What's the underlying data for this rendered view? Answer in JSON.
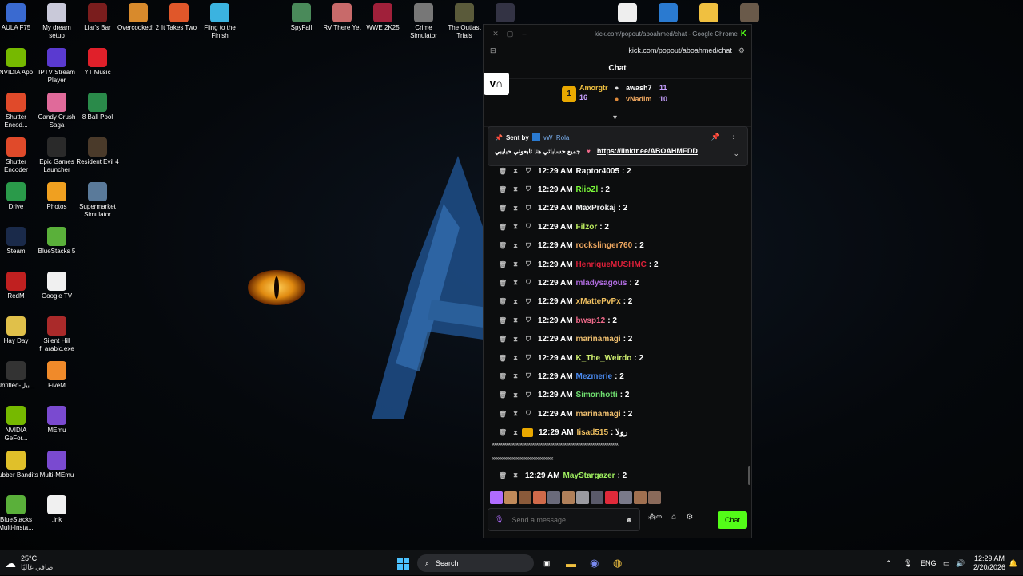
{
  "desktop_icons": [
    {
      "label": "AULA F75",
      "icon": "keyboard-icon",
      "color": "#3a6ad0"
    },
    {
      "label": "My dream setup",
      "icon": "game-icon",
      "color": "#c9c9d9"
    },
    {
      "label": "Liar's Bar",
      "icon": "game-icon",
      "color": "#7a1d1d"
    },
    {
      "label": "Overcooked! 2",
      "icon": "game-icon",
      "color": "#d88a2c"
    },
    {
      "label": "It Takes Two",
      "icon": "game-icon",
      "color": "#e0572a"
    },
    {
      "label": "Fling to the Finish",
      "icon": "game-icon",
      "color": "#3bb3e0"
    },
    {
      "label": "SpyFall",
      "icon": "game-icon",
      "color": "#4a8a5a"
    },
    {
      "label": "RV There Yet",
      "icon": "game-icon",
      "color": "#c86a6a"
    },
    {
      "label": "WWE 2K25",
      "icon": "game-icon",
      "color": "#a0203a"
    },
    {
      "label": "Crime Simulator",
      "icon": "game-icon",
      "color": "#777777"
    },
    {
      "label": "The Outlast Trials",
      "icon": "game-icon",
      "color": "#5a5a3a"
    },
    {
      "label": "",
      "icon": "game-icon",
      "color": "#333344"
    },
    {
      "label": "",
      "icon": "document-icon",
      "color": "#eeeeee"
    },
    {
      "label": "",
      "icon": "game-icon",
      "color": "#2a7ad0"
    },
    {
      "label": "",
      "icon": "folder-icon",
      "color": "#f0c040"
    },
    {
      "label": "",
      "icon": "game-icon",
      "color": "#6a5a4a"
    },
    {
      "label": "NVIDIA App",
      "icon": "nvidia-icon",
      "color": "#76b900"
    },
    {
      "label": "IPTV Stream Player",
      "icon": "tv-icon",
      "color": "#5a3ad0"
    },
    {
      "label": "YT Music",
      "icon": "music-icon",
      "color": "#e0202a"
    },
    {
      "label": "Shutter Encod...",
      "icon": "shutter-icon",
      "color": "#e04a2a"
    },
    {
      "label": "Candy Crush Saga",
      "icon": "game-icon",
      "color": "#e06a9a"
    },
    {
      "label": "8 Ball Pool",
      "icon": "game-icon",
      "color": "#2a8a4a"
    },
    {
      "label": "Shutter Encoder",
      "icon": "shutter-icon",
      "color": "#e04a2a"
    },
    {
      "label": "Epic Games Launcher",
      "icon": "epic-icon",
      "color": "#2a2a2a"
    },
    {
      "label": "Resident Evil 4",
      "icon": "game-icon",
      "color": "#4a3a2a"
    },
    {
      "label": "Drive",
      "icon": "drive-icon",
      "color": "#2a9a4a"
    },
    {
      "label": "Photos",
      "icon": "photos-icon",
      "color": "#f0a020"
    },
    {
      "label": "Supermarket Simulator",
      "icon": "game-icon",
      "color": "#5a7a9a"
    },
    {
      "label": "Steam",
      "icon": "steam-icon",
      "color": "#1a2a4a"
    },
    {
      "label": "BlueStacks 5",
      "icon": "bluestacks-icon",
      "color": "#5ab03a"
    },
    {
      "label": "RedM",
      "icon": "redm-icon",
      "color": "#c02020"
    },
    {
      "label": "Google TV",
      "icon": "tv-icon",
      "color": "#f0f0f0"
    },
    {
      "label": "Hay Day",
      "icon": "game-icon",
      "color": "#e0c04a"
    },
    {
      "label": "Silent Hill f_arabic.exe",
      "icon": "exe-icon",
      "color": "#aa2a2a"
    },
    {
      "label": "Untitled-بيل...",
      "icon": "file-icon",
      "color": "#333333"
    },
    {
      "label": "FiveM",
      "icon": "fivem-icon",
      "color": "#f08a2a"
    },
    {
      "label": "NVIDIA GeFor...",
      "icon": "nvidia-icon",
      "color": "#76b900"
    },
    {
      "label": "MEmu",
      "icon": "memu-icon",
      "color": "#7a4ad0"
    },
    {
      "label": "Rubber Bandits",
      "icon": "game-icon",
      "color": "#e0c02a"
    },
    {
      "label": "Multi-MEmu",
      "icon": "memu-icon",
      "color": "#7a4ad0"
    },
    {
      "label": "BlueStacks Multi-Insta...",
      "icon": "bluestacks-icon",
      "color": "#5ab03a"
    },
    {
      "label": ".lnk",
      "icon": "file-icon",
      "color": "#f0f0f0"
    }
  ],
  "browser": {
    "title": "kick.com/popout/aboahmed/chat - Google Chrome",
    "url": "kick.com/popout/aboahmed/chat"
  },
  "chat": {
    "header": "Chat",
    "logo_text": "ᴠ∩",
    "leaderboard": {
      "rank1": {
        "rank": "1",
        "name": "Amorgtr",
        "count": "16"
      },
      "rank2": {
        "name": "awash7",
        "count": "11"
      },
      "rank3": {
        "name": "vNadim",
        "count": "10"
      }
    },
    "pinned": {
      "sent_by_label": "Sent by",
      "sender": "vW_Rola",
      "text": "جميع حساباتي هنا تابعوني حبايبي",
      "link": "https://linktr.ee/ABOAHMEDD"
    },
    "messages": [
      {
        "time": "12:29 AM",
        "user": "Raptor4005",
        "value": ": 2",
        "color": "#ffffff"
      },
      {
        "time": "12:29 AM",
        "user": "RiioZl",
        "value": ": 2",
        "color": "#7cfc3a"
      },
      {
        "time": "12:29 AM",
        "user": "MaxProkaj",
        "value": ": 2",
        "color": "#f0f0f0"
      },
      {
        "time": "12:29 AM",
        "user": "Filzor",
        "value": ": 2",
        "color": "#c0f060"
      },
      {
        "time": "12:29 AM",
        "user": "rockslinger760",
        "value": ": 2",
        "color": "#f0a860"
      },
      {
        "time": "12:29 AM",
        "user": "HenriqueMUSHMC",
        "value": ": 2",
        "color": "#e0203a"
      },
      {
        "time": "12:29 AM",
        "user": "mladysagous",
        "value": ": 2",
        "color": "#b06ce0"
      },
      {
        "time": "12:29 AM",
        "user": "xMattePvPx",
        "value": ": 2",
        "color": "#f0c060"
      },
      {
        "time": "12:29 AM",
        "user": "bwsp12",
        "value": ": 2",
        "color": "#f06a8a"
      },
      {
        "time": "12:29 AM",
        "user": "marinamagi",
        "value": ": 2",
        "color": "#f0c070"
      },
      {
        "time": "12:29 AM",
        "user": "K_The_Weirdo",
        "value": ": 2",
        "color": "#d0f070"
      },
      {
        "time": "12:29 AM",
        "user": "Mezmerie",
        "value": ": 2",
        "color": "#4a8af0"
      },
      {
        "time": "12:29 AM",
        "user": "Simonhotti",
        "value": ": 2",
        "color": "#70e070"
      },
      {
        "time": "12:29 AM",
        "user": "marinamagi",
        "value": ": 2",
        "color": "#f0c070"
      },
      {
        "time": "12:29 AM",
        "user": "Iisad515",
        "value": ": رولا",
        "color": "#f0c060",
        "crown": true
      }
    ],
    "spam_line_1": "‹‹‹‹‹‹‹‹‹‹‹‹‹‹‹‹‹‹‹‹‹‹‹‹‹‹‹‹‹‹‹‹‹‹‹‹‹‹‹‹‹‹‹‹‹‹‹‹‹‹‹‹‹‹‹‹‹‹‹‹‹‹‹‹‹‹‹‹‹‹‹‹‹‹‹‹‹‹‹‹‹‹‹‹‹‹‹‹‹‹‹‹‹‹‹",
    "spam_line_2": "‹‹‹‹‹‹‹‹‹‹‹‹‹‹‹‹‹‹‹‹‹‹‹‹‹‹‹‹‹‹‹‹‹‹‹‹‹‹‹‹‹‹‹‹‹‹",
    "last_message": {
      "time": "12:29 AM",
      "user": "MayStargazer",
      "value": ": 2",
      "color": "#a0f060"
    },
    "composer_placeholder": "Send a message",
    "send_label": "Chat",
    "accent": "#53fc18"
  },
  "taskbar": {
    "weather_temp": "25°C",
    "weather_desc": "صافي غالبًا",
    "search_label": "Search",
    "language": "ENG",
    "time": "12:29 AM",
    "date": "2/20/2026"
  }
}
